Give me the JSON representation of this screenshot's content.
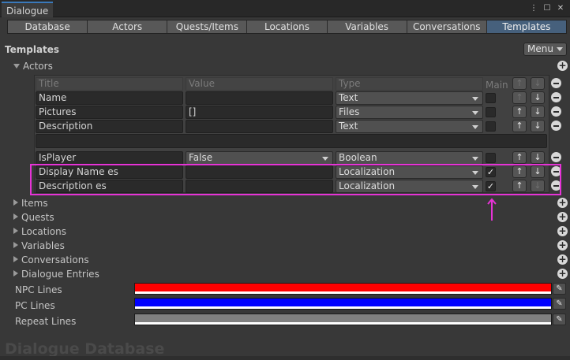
{
  "window": {
    "title": "Dialogue",
    "icons": [
      "more-menu-icon",
      "maximize-icon",
      "close-icon"
    ]
  },
  "tabs": [
    {
      "label": "Database",
      "active": false
    },
    {
      "label": "Actors",
      "active": false
    },
    {
      "label": "Quests/Items",
      "active": false
    },
    {
      "label": "Locations",
      "active": false
    },
    {
      "label": "Variables",
      "active": false
    },
    {
      "label": "Conversations",
      "active": false
    },
    {
      "label": "Templates",
      "active": true
    }
  ],
  "section": {
    "title": "Templates",
    "menu_label": "Menu"
  },
  "actors": {
    "label": "Actors",
    "headers": {
      "title": "Title",
      "value": "Value",
      "type": "Type",
      "main": "Main"
    },
    "rows": [
      {
        "title": "Name",
        "value": "",
        "type": "Text",
        "main": false,
        "up": false,
        "down": true
      },
      {
        "title": "Pictures",
        "value": "[]",
        "type": "Files",
        "main": false,
        "up": true,
        "down": true
      },
      {
        "title": "Description",
        "value": "",
        "type": "Text",
        "main": false,
        "up": true,
        "down": true
      },
      {
        "title": "IsPlayer",
        "value": "False",
        "type": "Boolean",
        "main": false,
        "up": true,
        "down": true
      },
      {
        "title": "Display Name es",
        "value": "",
        "type": "Localization",
        "main": true,
        "up": true,
        "down": true
      },
      {
        "title": "Description es",
        "value": "",
        "type": "Localization",
        "main": true,
        "up": true,
        "down": false
      }
    ]
  },
  "foldouts": [
    "Items",
    "Quests",
    "Locations",
    "Variables",
    "Conversations",
    "Dialogue Entries"
  ],
  "colors": [
    {
      "label": "NPC Lines",
      "color": "#ff0000"
    },
    {
      "label": "PC Lines",
      "color": "#0000ff"
    },
    {
      "label": "Repeat Lines",
      "color": "#808080"
    }
  ],
  "footer": "Dialogue Database",
  "accent": {
    "highlight": "#e633d6",
    "active_tab": "#46607c"
  }
}
